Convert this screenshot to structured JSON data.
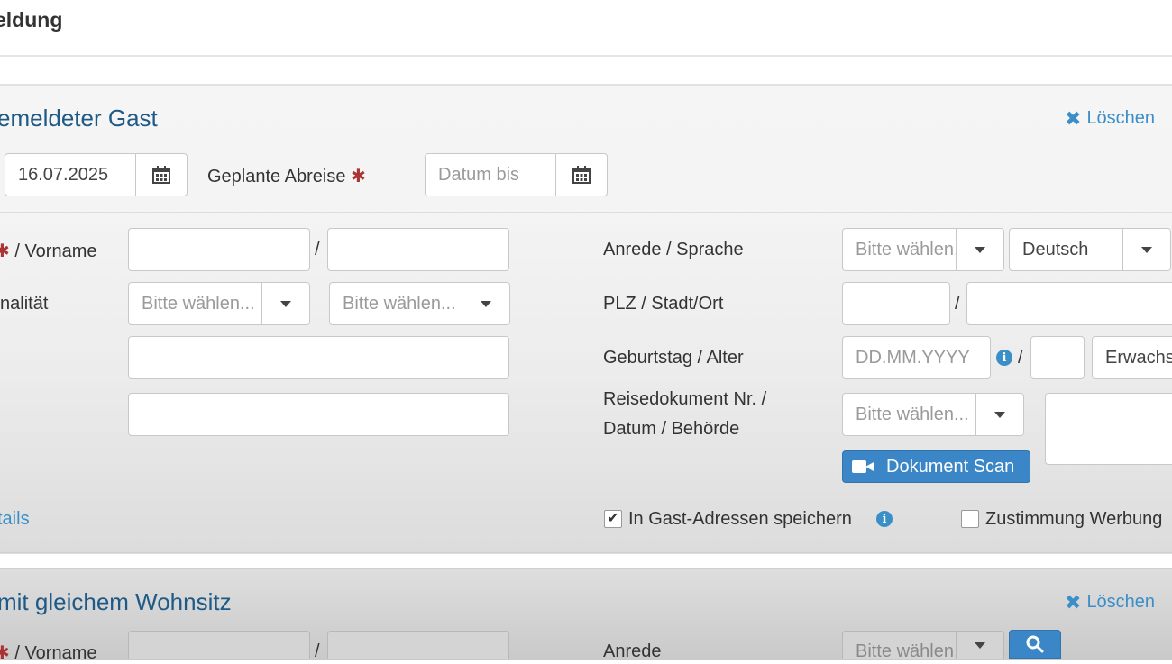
{
  "header": {
    "title": "eldung"
  },
  "guest_section": {
    "title": "emeldeter Gast",
    "delete_label": "Löschen",
    "arrival_date": "16.07.2025",
    "planned_departure_label": "Geplante Abreise",
    "required_mark": "✱",
    "departure_placeholder": "Datum bis",
    "name_label_suffix": "/ Vorname",
    "nationality_label": "nalität",
    "nationality_placeholder_1": "Bitte wählen...",
    "nationality_placeholder_2": "Bitte wählen...",
    "salutation_language_label": "Anrede / Sprache",
    "salutation_placeholder": "Bitte wählen...",
    "language_value": "Deutsch",
    "zip_city_label": "PLZ / Stadt/Ort",
    "birthday_age_label": "Geburtstag / Alter",
    "birthday_placeholder": "DD.MM.YYYY",
    "age_category_value": "Erwachsen",
    "travel_doc_label_line1": "Reisedokument Nr. /",
    "travel_doc_label_line2": "Datum / Behörde",
    "travel_doc_placeholder": "Bitte wählen...",
    "scan_button_label": "Dokument Scan",
    "details_link": "tails",
    "save_address_label": "In Gast-Adressen speichern",
    "save_address_checked": true,
    "consent_label": "Zustimmung Werbung",
    "consent_checked": false
  },
  "same_residence_section": {
    "title": "mit gleichem Wohnsitz",
    "delete_label": "Löschen",
    "name_label_suffix": "/ Vorname",
    "salutation_label": "Anrede",
    "salutation_placeholder": "Bitte wählen..."
  },
  "colors": {
    "title_blue": "#1f5a86",
    "link_blue": "#3a8fc9",
    "button_blue": "#3a86c6",
    "required_red": "#a33333"
  }
}
